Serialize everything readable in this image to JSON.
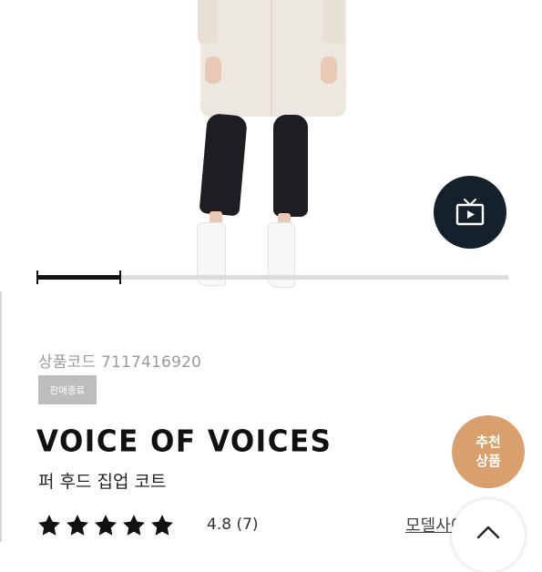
{
  "product": {
    "code_text": "상품코드 7117416920",
    "status_badge": "판매종료",
    "brand": "VOICE OF VOICES",
    "name": "퍼 후드 집업 코트",
    "rating_text": "4.8 (7)",
    "rating_stars": 5,
    "model_link": "모델사이즈"
  },
  "gallery": {
    "progress": 0.18,
    "video_icon": "tv-play-icon"
  },
  "recommend": {
    "line1": "추천",
    "line2": "상품"
  },
  "scroll_top_icon": "chevron-up-icon",
  "colors": {
    "recommend_badge": "#d9a06d",
    "video_button": "#14202b",
    "status_badge": "#bdbdbd",
    "star": "#111111"
  }
}
